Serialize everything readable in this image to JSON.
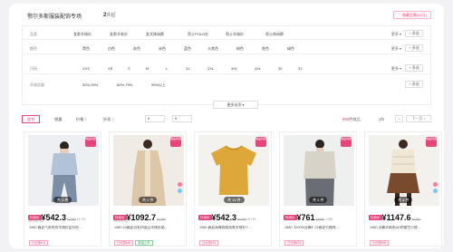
{
  "header": {
    "title": "鄂尔多斯服装配饰专场",
    "count": "2",
    "count_unit": "件起",
    "favorite": "♡ 收藏品牌(65万)"
  },
  "filters": {
    "more_label": "更多 ▾",
    "multi_label": "+ 多选",
    "rows": [
      {
        "label": "品类",
        "options": [
          "女款羊绒衫",
          "女款羊毛衫",
          "女式休闲裤",
          "男士POLO衫",
          "男士羊绒衫",
          "男士休闲裤"
        ]
      },
      {
        "label": "颜色",
        "options": [
          "黑色",
          "白色",
          "灰色",
          "米色",
          "蓝色",
          "卡其色",
          "粉色",
          "驼色",
          "绿色"
        ]
      },
      {
        "label": "尺码",
        "options": [
          "XXS",
          "XS",
          "S",
          "M",
          "L",
          "XL",
          "2XL",
          "3XL",
          "4XL",
          "30",
          "31"
        ]
      },
      {
        "label": "羊绒含量",
        "options": [
          "30%-59%",
          "60%-79%",
          "95%以上"
        ]
      }
    ],
    "more_options": "更多选项 ▾"
  },
  "sortbar": {
    "items": [
      "综合",
      "销量",
      "价格 ↕",
      "折扣 ↕"
    ],
    "price_from": "¥",
    "price_to": "¥",
    "sep": "-",
    "found_count": "992",
    "found_suffix": "件商品",
    "page": "1/5",
    "prev": "<",
    "next": "下一页 >"
  },
  "products": [
    {
      "badge": "唯品特卖",
      "imgcount": "共 3 件",
      "tag": "特卖价",
      "price": "¥542.3",
      "old": "¥1780",
      "extra": "¥1790",
      "sub": "60天价前",
      "name": "1980 春夏气质时尚羊绒衫女针织…",
      "tags": [
        "已优惠¥33"
      ]
    },
    {
      "badge": "唯品特卖",
      "imgcount": "共 2 件",
      "tag": "特卖价",
      "price": "¥1092.7",
      "old": "¥1780",
      "extra": "",
      "sub": "60天价前",
      "name": "1980 24春夏羽毛四面山羊绒长裙…",
      "tags": [
        "已优惠¥89",
        "新品上市"
      ]
    },
    {
      "badge": "唯品特卖",
      "imgcount": "共 16 件",
      "tag": "特卖价",
      "price": "¥542.3",
      "old": "¥1780",
      "extra": "¥1790",
      "sub": "",
      "name": "1980 春夏高端简版短款羊绒衫T…",
      "tags": [
        "已优惠¥33"
      ]
    },
    {
      "badge": "唯品特卖",
      "imgcount": "共 3 件",
      "tag": "特卖价",
      "price": "¥761",
      "old": "¥1980",
      "extra": "1.8折",
      "sub": "",
      "name": "1980【100%亚麻】22春夏七袖休…",
      "tags": [
        "已优惠¥33"
      ]
    },
    {
      "badge": "唯品特卖",
      "imgcount": "共 4 件",
      "tag": "特卖价",
      "price": "¥1147.6",
      "old": "¥1390",
      "extra": "",
      "sub": "",
      "name": "1980 浮雕羊绒毛AD的镂空小修…",
      "tags": [
        "已优惠¥89"
      ]
    }
  ],
  "colors": {
    "accent": "#e4457a",
    "swatch_pink": "#f57aa8",
    "swatch_blue": "#7fc6ef"
  }
}
